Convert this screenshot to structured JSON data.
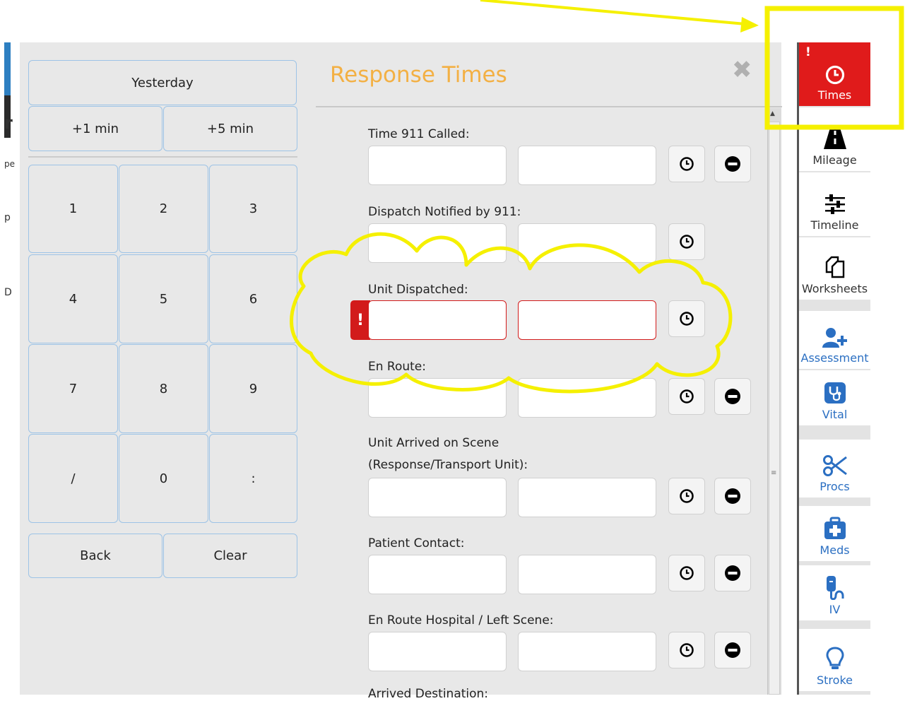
{
  "keypad": {
    "yesterday": "Yesterday",
    "plus1": "+1 min",
    "plus5": "+5 min",
    "keys": [
      "1",
      "2",
      "3",
      "4",
      "5",
      "6",
      "7",
      "8",
      "9",
      "/",
      "0",
      ":"
    ],
    "back": "Back",
    "clear": "Clear"
  },
  "dialog": {
    "title": "Response Times",
    "close_icon": "close-x-icon",
    "fields": [
      {
        "label": "Time 911 Called:",
        "date": "",
        "time": "",
        "has_clear": true,
        "error": false
      },
      {
        "label": "Dispatch Notified by 911:",
        "date": "",
        "time": "",
        "has_clear": false,
        "error": false
      },
      {
        "label": "Unit Dispatched:",
        "date": "",
        "time": "",
        "has_clear": false,
        "error": true
      },
      {
        "label": "En Route:",
        "date": "",
        "time": "",
        "has_clear": true,
        "error": false
      },
      {
        "label": "Unit Arrived on Scene",
        "label2": "(Response/Transport Unit):",
        "date": "",
        "time": "",
        "has_clear": true,
        "error": false
      },
      {
        "label": "Patient Contact:",
        "date": "",
        "time": "",
        "has_clear": true,
        "error": false
      },
      {
        "label": "En Route Hospital / Left Scene:",
        "date": "",
        "time": "",
        "has_clear": true,
        "error": false
      },
      {
        "label": "Arrived Destination:"
      }
    ],
    "error_mark": "!"
  },
  "left_partial": {
    "chars": [
      "r",
      "pe",
      "p",
      "D"
    ]
  },
  "rail": {
    "items": [
      {
        "label": "Times",
        "icon": "clock-icon",
        "active": true,
        "alert": "!"
      },
      {
        "label": "Mileage",
        "icon": "road-icon"
      },
      {
        "label": "Timeline",
        "icon": "sliders-icon"
      },
      {
        "label": "Worksheets",
        "icon": "copy-icon"
      },
      {
        "label": "Assessment",
        "icon": "user-plus-icon"
      },
      {
        "label": "Vital",
        "icon": "stethoscope-icon"
      },
      {
        "label": "Procs",
        "icon": "scissors-icon"
      },
      {
        "label": "Meds",
        "icon": "medkit-icon"
      },
      {
        "label": "IV",
        "icon": "iv-drip-icon"
      },
      {
        "label": "Stroke",
        "icon": "lightbulb-icon"
      }
    ]
  },
  "colors": {
    "title": "#f3b044",
    "active_tab": "#e01b1b",
    "error": "#d21b1b",
    "link_blue": "#2b6fc2",
    "annotation": "#f5f000"
  }
}
